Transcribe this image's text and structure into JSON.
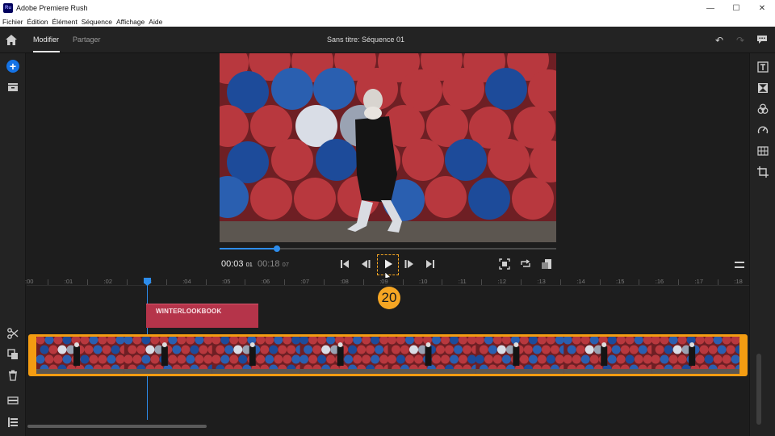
{
  "window": {
    "app_logo": "Ru",
    "title": "Adobe Premiere Rush",
    "minimize": "—",
    "maximize": "☐",
    "close": "✕"
  },
  "menu": [
    "Fichier",
    "Édition",
    "Élément",
    "Séquence",
    "Affichage",
    "Aide"
  ],
  "header": {
    "tabs": [
      {
        "label": "Modifier",
        "active": true
      },
      {
        "label": "Partager",
        "active": false
      }
    ],
    "sequence_title": "Sans titre: Séquence  01"
  },
  "left_toolbar": {
    "add": "+"
  },
  "transport": {
    "current_time": "00:03",
    "current_frames": "01",
    "duration": "00:18",
    "duration_frames": "07",
    "scrub_progress": 0.17
  },
  "timeline": {
    "ruler_labels": [
      ":00",
      ":01",
      ":02",
      ":03",
      ":04",
      ":05",
      ":06",
      ":07",
      ":08",
      ":09",
      ":10",
      ":11",
      ":12",
      ":13",
      ":14",
      ":15",
      ":16",
      ":17",
      ":18"
    ],
    "title_clip": "WINTERLOOKBOOK",
    "step_number": "20"
  },
  "colors": {
    "accent_blue": "#2d8ceb",
    "step_orange": "#f6a623",
    "title_clip": "#b5344a",
    "video_clip_border": "#f39c12"
  }
}
